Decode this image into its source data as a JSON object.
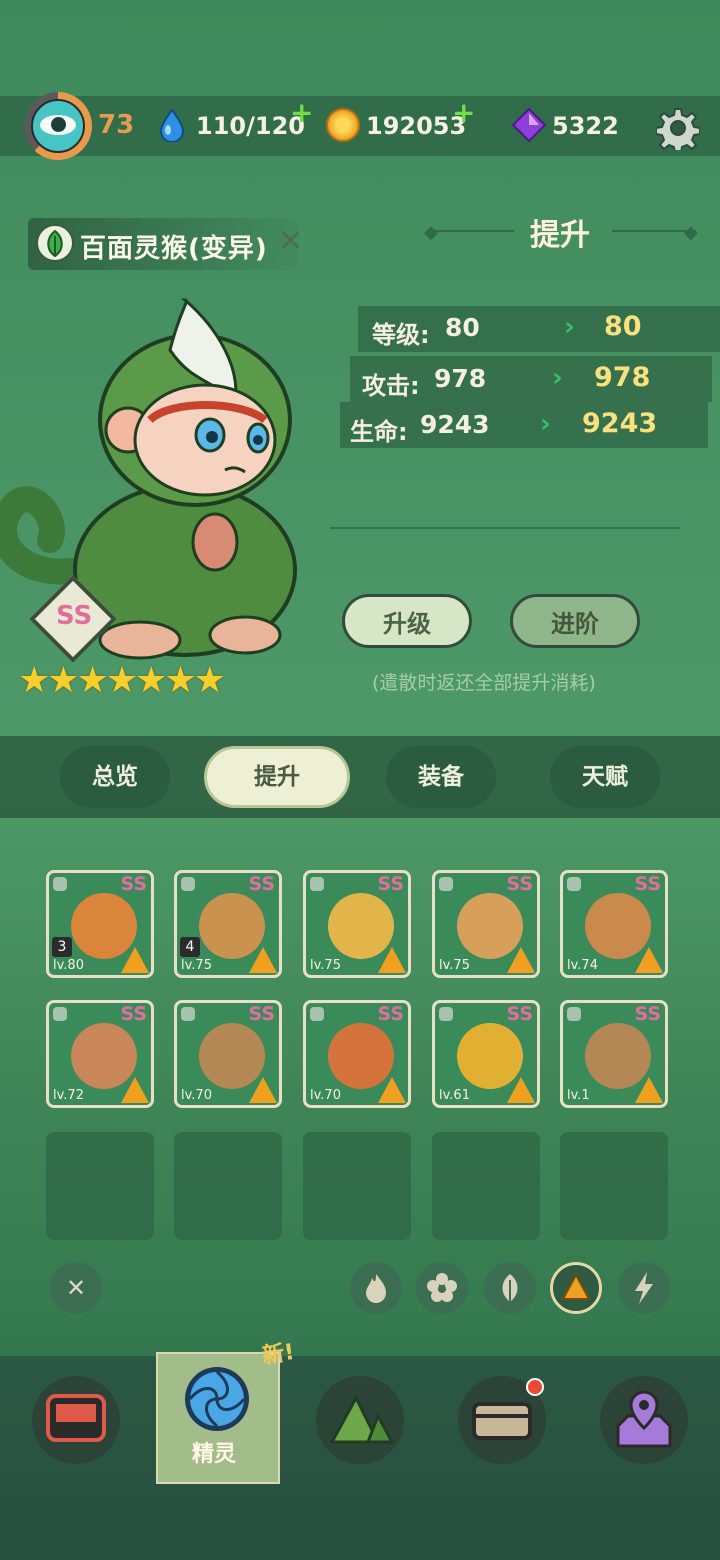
{
  "top_bar": {
    "player_level": "73",
    "stamina": "110/120",
    "coins": "192053",
    "gems": "5322"
  },
  "pet": {
    "name": "百面灵猴(变异)",
    "rarity": "SS",
    "stars": 7
  },
  "upgrade_panel": {
    "title": "提升",
    "stats": [
      {
        "label": "等级:",
        "current": "80",
        "next": "80"
      },
      {
        "label": "攻击:",
        "current": "978",
        "next": "978"
      },
      {
        "label": "生命:",
        "current": "9243",
        "next": "9243"
      }
    ],
    "level_up_label": "升级",
    "advance_label": "进阶",
    "hint": "(遣散时返还全部提升消耗)"
  },
  "tabs": [
    {
      "label": "总览",
      "active": false
    },
    {
      "label": "提升",
      "active": true
    },
    {
      "label": "装备",
      "active": false
    },
    {
      "label": "天赋",
      "active": false
    }
  ],
  "pet_list": [
    {
      "rarity": "SS",
      "level": "lv.80",
      "count": "3",
      "art_color": "#d9863a"
    },
    {
      "rarity": "SS",
      "level": "lv.75",
      "count": "4",
      "art_color": "#c9924e"
    },
    {
      "rarity": "SS",
      "level": "lv.75",
      "count": "",
      "art_color": "#e2b54a"
    },
    {
      "rarity": "SS",
      "level": "lv.75",
      "count": "",
      "art_color": "#d6a05a"
    },
    {
      "rarity": "SS",
      "level": "lv.74",
      "count": "",
      "art_color": "#c98a4c"
    },
    {
      "rarity": "SS",
      "level": "lv.72",
      "count": "",
      "art_color": "#c98658"
    },
    {
      "rarity": "SS",
      "level": "lv.70",
      "count": "",
      "art_color": "#b38855"
    },
    {
      "rarity": "SS",
      "level": "lv.70",
      "count": "",
      "art_color": "#d4743c"
    },
    {
      "rarity": "SS",
      "level": "lv.61",
      "count": "",
      "art_color": "#e1b032"
    },
    {
      "rarity": "SS",
      "level": "lv.1",
      "count": "",
      "art_color": "#b38855"
    }
  ],
  "filters": {
    "clear": "✕",
    "elements": [
      "fire-icon",
      "flower-icon",
      "leaf-icon",
      "earth-icon",
      "lightning-icon"
    ],
    "active": "earth-icon"
  },
  "bottom_nav": {
    "active_label": "精灵",
    "new_tag": "新!"
  }
}
